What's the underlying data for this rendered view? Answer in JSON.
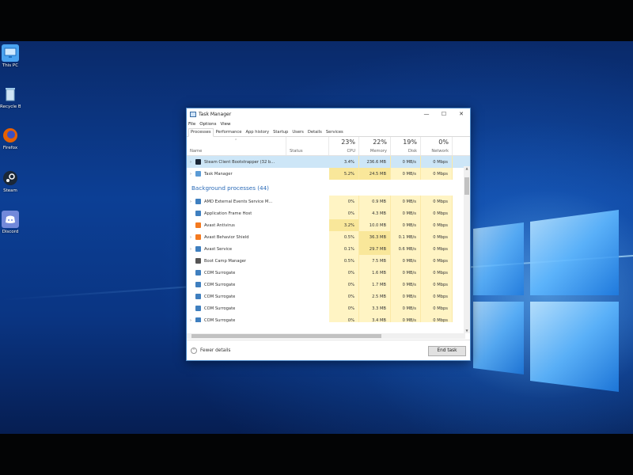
{
  "desktop": {
    "icons": [
      {
        "label": "This PC",
        "icon": "computer-icon",
        "color": "#4aa3f0"
      },
      {
        "label": "Recycle Bin",
        "icon": "recycle-bin-icon",
        "color": "#9fc9e8"
      },
      {
        "label": "Firefox",
        "icon": "firefox-icon",
        "color": "#e66000"
      },
      {
        "label": "Steam",
        "icon": "steam-icon",
        "color": "#1b2838"
      },
      {
        "label": "Discord",
        "icon": "discord-icon",
        "color": "#7289da"
      }
    ]
  },
  "window": {
    "title": "Task Manager",
    "minimize": "—",
    "maximize": "☐",
    "close": "✕"
  },
  "menu": [
    "File",
    "Options",
    "View"
  ],
  "tabs": [
    "Processes",
    "Performance",
    "App history",
    "Startup",
    "Users",
    "Details",
    "Services"
  ],
  "columns": {
    "name": "Name",
    "status": "Status",
    "cpu": {
      "pct": "23%",
      "label": "CPU"
    },
    "memory": {
      "pct": "22%",
      "label": "Memory"
    },
    "disk": {
      "pct": "19%",
      "label": "Disk"
    },
    "network": {
      "pct": "0%",
      "label": "Network"
    }
  },
  "apps": [
    {
      "name": "Steam Client Bootstrapper (32 b...",
      "icon": "steam-icon",
      "cpu": "3.4%",
      "memory": "236.6 MB",
      "disk": "0 MB/s",
      "network": "0 Mbps",
      "selected": true
    },
    {
      "name": "Task Manager",
      "icon": "task-manager-icon",
      "cpu": "5.2%",
      "memory": "24.5 MB",
      "disk": "0 MB/s",
      "network": "0 Mbps",
      "selected": false
    }
  ],
  "background_group": "Background processes (44)",
  "background": [
    {
      "name": "AMD External Events Service M...",
      "icon": "service-icon",
      "cpu": "0%",
      "memory": "0.9 MB",
      "disk": "0 MB/s",
      "network": "0 Mbps",
      "expandable": true
    },
    {
      "name": "Application Frame Host",
      "icon": "service-icon",
      "cpu": "0%",
      "memory": "4.3 MB",
      "disk": "0 MB/s",
      "network": "0 Mbps",
      "expandable": false
    },
    {
      "name": "Avast Antivirus",
      "icon": "avast-icon",
      "cpu": "3.2%",
      "memory": "10.0 MB",
      "disk": "0 MB/s",
      "network": "0 Mbps",
      "expandable": false
    },
    {
      "name": "Avast Behavior Shield",
      "icon": "avast-icon",
      "cpu": "0.5%",
      "memory": "36.3 MB",
      "disk": "0.1 MB/s",
      "network": "0 Mbps",
      "expandable": true
    },
    {
      "name": "Avast Service",
      "icon": "service-icon",
      "cpu": "0.1%",
      "memory": "29.7 MB",
      "disk": "0.6 MB/s",
      "network": "0 Mbps",
      "expandable": true
    },
    {
      "name": "Boot Camp Manager",
      "icon": "bootcamp-icon",
      "cpu": "0.5%",
      "memory": "7.5 MB",
      "disk": "0 MB/s",
      "network": "0 Mbps",
      "expandable": false
    },
    {
      "name": "COM Surrogate",
      "icon": "service-icon",
      "cpu": "0%",
      "memory": "1.6 MB",
      "disk": "0 MB/s",
      "network": "0 Mbps",
      "expandable": false
    },
    {
      "name": "COM Surrogate",
      "icon": "service-icon",
      "cpu": "0%",
      "memory": "1.7 MB",
      "disk": "0 MB/s",
      "network": "0 Mbps",
      "expandable": false
    },
    {
      "name": "COM Surrogate",
      "icon": "service-icon",
      "cpu": "0%",
      "memory": "2.5 MB",
      "disk": "0 MB/s",
      "network": "0 Mbps",
      "expandable": false
    },
    {
      "name": "COM Surrogate",
      "icon": "service-icon",
      "cpu": "0%",
      "memory": "3.3 MB",
      "disk": "0 MB/s",
      "network": "0 Mbps",
      "expandable": false
    },
    {
      "name": "COM Surrogate",
      "icon": "service-icon",
      "cpu": "0%",
      "memory": "3.4 MB",
      "disk": "0 MB/s",
      "network": "0 Mbps",
      "expandable": true
    }
  ],
  "footer": {
    "fewer_details": "Fewer details",
    "end_task": "End task"
  },
  "colors": {
    "accent": "#2a6ab7",
    "heat_light": "#fff4c4",
    "heat_strong": "#f9e79a",
    "selected": "#cde6f7"
  }
}
